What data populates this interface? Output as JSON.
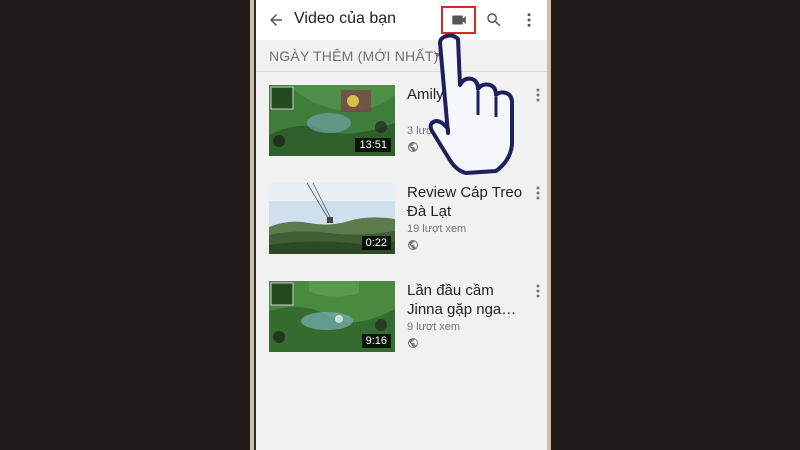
{
  "header": {
    "title": "Video của bạn",
    "back_icon": "arrow-back-icon",
    "camera_icon": "video-camera-icon",
    "search_icon": "search-icon",
    "more_icon": "more-vert-icon",
    "highlight_color": "#d62828"
  },
  "sort": {
    "label": "NGÀY THÊM (MỚI NHẤT)",
    "icon": "dropdown-arrow-icon"
  },
  "videos": [
    {
      "title": "Amily có t",
      "views": "3 lượt",
      "duration": "13:51",
      "visibility_icon": "globe-icon"
    },
    {
      "title": "Review Cáp Treo Đà Lạt",
      "views": "19 lượt xem",
      "duration": "0:22",
      "visibility_icon": "globe-icon"
    },
    {
      "title": "Lần đầu cầm Jinna gặp nga…",
      "views": "9 lượt xem",
      "duration": "9:16",
      "visibility_icon": "globe-icon"
    }
  ],
  "overlay": {
    "icon": "pointing-hand-icon"
  }
}
